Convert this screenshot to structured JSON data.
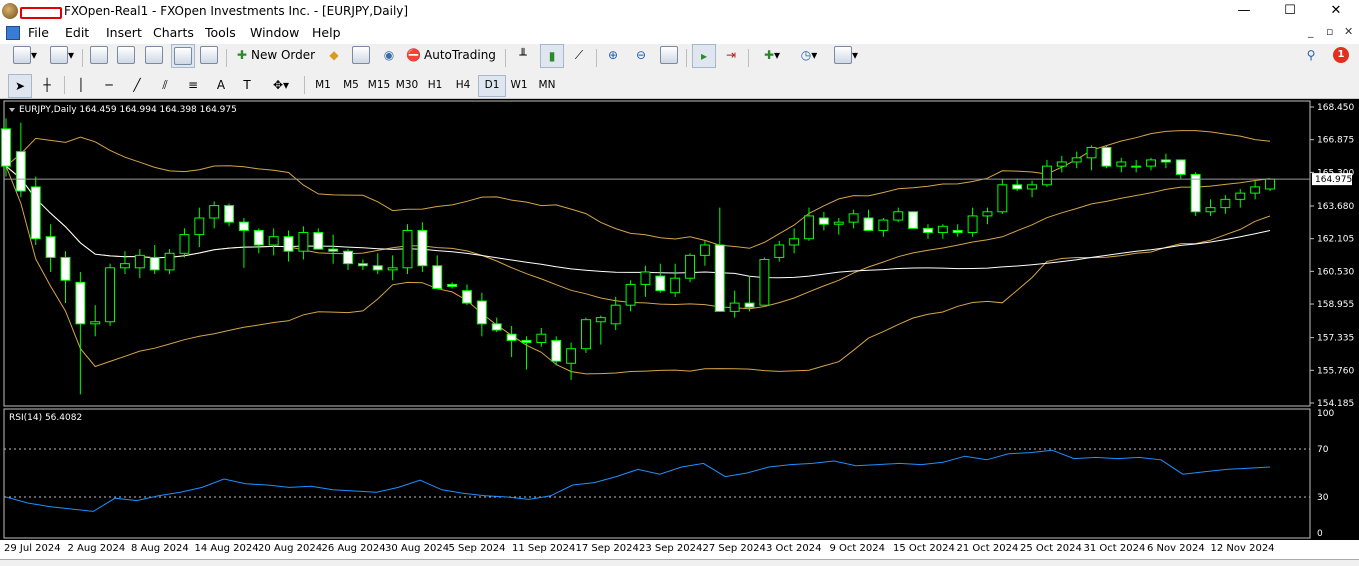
{
  "window": {
    "title": "FXOpen-Real1 - FXOpen Investments Inc. - [EURJPY,Daily]",
    "controls": {
      "minimize": "—",
      "maximize": "☐",
      "close": "✕"
    }
  },
  "menu": {
    "items": [
      "File",
      "Edit",
      "Insert",
      "Charts",
      "Tools",
      "Window",
      "Help"
    ],
    "mdi": {
      "minimize": "_",
      "restore": "▫",
      "close": "✕"
    }
  },
  "toolbar": {
    "new_order_label": "New Order",
    "autotrading_label": "AutoTrading",
    "notification_count": "1"
  },
  "timeframes": [
    "M1",
    "M5",
    "M15",
    "M30",
    "H1",
    "H4",
    "D1",
    "W1",
    "MN"
  ],
  "active_timeframe": "D1",
  "main_chart": {
    "header": "EURJPY,Daily  164.459 164.994 164.398 164.975",
    "current_price": "164.975",
    "price_ticks": [
      "168.450",
      "166.875",
      "165.300",
      "163.680",
      "162.105",
      "160.530",
      "158.955",
      "157.335",
      "155.760",
      "154.185"
    ],
    "price_range": [
      154.185,
      168.45
    ]
  },
  "rsi_panel": {
    "header": "RSI(14) 56.4082",
    "ticks": [
      "100",
      "70",
      "30",
      "0"
    ],
    "levels": [
      30,
      70
    ]
  },
  "x_axis_labels": [
    "29 Jul 2024",
    "2 Aug 2024",
    "8 Aug 2024",
    "14 Aug 2024",
    "20 Aug 2024",
    "26 Aug 2024",
    "30 Aug 2024",
    "5 Sep 2024",
    "11 Sep 2024",
    "17 Sep 2024",
    "23 Sep 2024",
    "27 Sep 2024",
    "3 Oct 2024",
    "9 Oct 2024",
    "15 Oct 2024",
    "21 Oct 2024",
    "25 Oct 2024",
    "31 Oct 2024",
    "6 Nov 2024",
    "12 Nov 2024"
  ],
  "colors": {
    "chart_bg": "#000000",
    "bull_body": "#000000",
    "bear_body": "#ffffff",
    "wick": "#00ff00",
    "ma_white": "#ffffff",
    "bollinger": "#d4a548",
    "rsi_line": "#1e90ff"
  },
  "chart_data": {
    "type": "candlestick",
    "symbol": "EURJPY",
    "timeframe": "Daily",
    "x": [
      "29 Jul 2024",
      "2 Aug 2024",
      "8 Aug 2024",
      "14 Aug 2024",
      "20 Aug 2024",
      "26 Aug 2024",
      "30 Aug 2024",
      "5 Sep 2024",
      "11 Sep 2024",
      "17 Sep 2024",
      "23 Sep 2024",
      "27 Sep 2024",
      "3 Oct 2024",
      "9 Oct 2024",
      "15 Oct 2024",
      "21 Oct 2024",
      "25 Oct 2024",
      "31 Oct 2024",
      "6 Nov 2024",
      "12 Nov 2024"
    ],
    "ohlc": [
      [
        167.4,
        167.9,
        165.1,
        165.6
      ],
      [
        166.3,
        167.7,
        164.1,
        164.4
      ],
      [
        164.6,
        165.1,
        161.8,
        162.1
      ],
      [
        162.2,
        162.8,
        160.5,
        161.2
      ],
      [
        161.2,
        161.5,
        159.0,
        160.1
      ],
      [
        160.0,
        160.5,
        154.6,
        158.0
      ],
      [
        158.0,
        158.9,
        157.4,
        158.1
      ],
      [
        158.1,
        160.9,
        157.9,
        160.7
      ],
      [
        160.7,
        161.5,
        160.4,
        160.9
      ],
      [
        160.7,
        161.6,
        160.2,
        161.3
      ],
      [
        161.2,
        161.8,
        160.4,
        160.6
      ],
      [
        160.6,
        161.6,
        160.4,
        161.4
      ],
      [
        161.4,
        162.6,
        161.2,
        162.3
      ],
      [
        162.3,
        163.6,
        161.7,
        163.1
      ],
      [
        163.1,
        163.9,
        162.6,
        163.7
      ],
      [
        163.7,
        163.8,
        162.7,
        162.9
      ],
      [
        162.9,
        163.1,
        160.7,
        162.5
      ],
      [
        162.5,
        162.6,
        161.4,
        161.8
      ],
      [
        161.8,
        162.6,
        161.3,
        162.2
      ],
      [
        162.2,
        162.5,
        161.0,
        161.5
      ],
      [
        161.5,
        162.7,
        161.1,
        162.4
      ],
      [
        162.4,
        162.6,
        161.6,
        161.6
      ],
      [
        161.6,
        162.3,
        160.9,
        161.5
      ],
      [
        161.5,
        161.6,
        160.6,
        160.9
      ],
      [
        160.9,
        161.1,
        160.6,
        160.8
      ],
      [
        160.8,
        161.4,
        160.4,
        160.6
      ],
      [
        160.6,
        161.3,
        160.1,
        160.7
      ],
      [
        160.7,
        162.8,
        160.4,
        162.5
      ],
      [
        162.5,
        162.9,
        160.5,
        160.8
      ],
      [
        160.8,
        161.3,
        159.8,
        159.7
      ],
      [
        159.9,
        160.0,
        159.7,
        159.8
      ],
      [
        159.6,
        159.9,
        158.9,
        159.0
      ],
      [
        159.1,
        159.5,
        157.4,
        158.0
      ],
      [
        158.0,
        158.3,
        157.6,
        157.7
      ],
      [
        157.5,
        157.9,
        156.4,
        157.2
      ],
      [
        157.2,
        157.4,
        155.8,
        157.1
      ],
      [
        157.1,
        157.8,
        156.9,
        157.5
      ],
      [
        157.2,
        157.4,
        156.0,
        156.2
      ],
      [
        156.1,
        157.1,
        155.3,
        156.8
      ],
      [
        156.8,
        158.3,
        156.6,
        158.2
      ],
      [
        158.1,
        158.4,
        157.0,
        158.3
      ],
      [
        158.0,
        159.3,
        157.7,
        158.9
      ],
      [
        158.9,
        160.1,
        158.6,
        159.9
      ],
      [
        159.9,
        160.8,
        159.3,
        160.5
      ],
      [
        160.3,
        160.9,
        159.5,
        159.6
      ],
      [
        159.5,
        160.9,
        159.3,
        160.2
      ],
      [
        160.2,
        161.4,
        160.0,
        161.3
      ],
      [
        161.3,
        162.0,
        160.8,
        161.8
      ],
      [
        161.8,
        163.6,
        158.8,
        158.6
      ],
      [
        158.6,
        159.6,
        158.3,
        159.0
      ],
      [
        159.0,
        160.3,
        158.6,
        158.8
      ],
      [
        158.9,
        161.2,
        158.9,
        161.1
      ],
      [
        161.2,
        162.0,
        161.0,
        161.8
      ],
      [
        161.8,
        162.6,
        161.4,
        162.1
      ],
      [
        162.1,
        163.6,
        162.0,
        163.2
      ],
      [
        163.1,
        163.4,
        162.5,
        162.8
      ],
      [
        162.8,
        163.1,
        162.3,
        162.9
      ],
      [
        162.9,
        163.5,
        162.6,
        163.3
      ],
      [
        163.1,
        163.5,
        162.6,
        162.5
      ],
      [
        162.5,
        163.1,
        162.2,
        163.0
      ],
      [
        163.0,
        163.6,
        162.9,
        163.4
      ],
      [
        163.4,
        163.4,
        162.6,
        162.6
      ],
      [
        162.6,
        162.8,
        162.1,
        162.4
      ],
      [
        162.4,
        162.8,
        162.1,
        162.7
      ],
      [
        162.5,
        162.8,
        162.2,
        162.4
      ],
      [
        162.4,
        163.6,
        162.2,
        163.2
      ],
      [
        163.2,
        163.6,
        162.8,
        163.4
      ],
      [
        163.4,
        165.0,
        163.3,
        164.7
      ],
      [
        164.7,
        165.0,
        164.4,
        164.5
      ],
      [
        164.5,
        164.9,
        164.1,
        164.7
      ],
      [
        164.7,
        165.9,
        164.6,
        165.6
      ],
      [
        165.6,
        166.1,
        165.3,
        165.8
      ],
      [
        165.8,
        166.3,
        165.5,
        166.0
      ],
      [
        166.0,
        166.6,
        165.4,
        166.5
      ],
      [
        166.5,
        166.6,
        165.5,
        165.6
      ],
      [
        165.6,
        166.0,
        165.3,
        165.8
      ],
      [
        165.6,
        165.9,
        165.3,
        165.6
      ],
      [
        165.6,
        166.0,
        165.4,
        165.9
      ],
      [
        165.9,
        166.2,
        165.5,
        165.8
      ],
      [
        165.9,
        165.9,
        165.0,
        165.2
      ],
      [
        165.2,
        165.3,
        163.2,
        163.4
      ],
      [
        163.4,
        164.0,
        163.2,
        163.6
      ],
      [
        163.6,
        164.2,
        163.3,
        164.0
      ],
      [
        164.0,
        164.5,
        163.6,
        164.3
      ],
      [
        164.3,
        164.9,
        164.0,
        164.6
      ],
      [
        164.5,
        165.0,
        164.4,
        164.975
      ]
    ],
    "rsi": [
      30,
      25,
      22,
      20,
      18,
      29,
      27,
      31,
      34,
      38,
      45,
      41,
      40,
      38,
      39,
      36,
      35,
      34,
      38,
      44,
      36,
      33,
      31,
      30,
      28,
      31,
      40,
      42,
      47,
      53,
      49,
      55,
      58,
      47,
      50,
      55,
      57,
      58,
      60,
      56,
      57,
      58,
      57,
      59,
      64,
      61,
      66,
      67,
      69,
      62,
      63,
      62,
      63,
      61,
      49,
      51,
      53,
      54,
      55
    ],
    "rsi_levels": [
      30,
      70
    ],
    "ylim": [
      154.185,
      168.45
    ]
  }
}
